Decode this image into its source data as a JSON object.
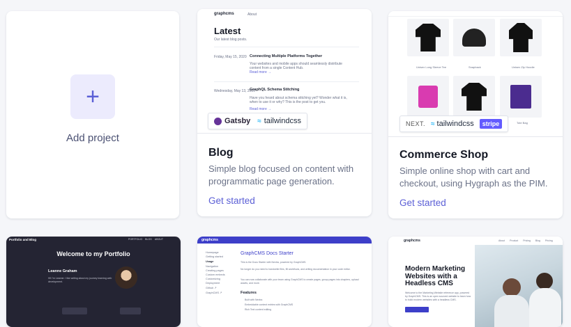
{
  "add_project": {
    "plus": "+",
    "label": "Add project"
  },
  "blog": {
    "title": "Blog",
    "description": "Simple blog focused on content with programmatic page generation.",
    "link": "Get started",
    "preview": {
      "brand": "graphcms",
      "nav": "About",
      "heading": "Latest",
      "subheading": "Our latest blog posts.",
      "posts": [
        {
          "date": "Friday, May 15, 2020",
          "title": "Connecting Multiple Platforms Together",
          "excerpt": "Your websites and mobile apps should seamlessly distribute content from a single Content Hub.",
          "more": "Read more →"
        },
        {
          "date": "Wednesday, May 13, 2020",
          "title": "GraphQL Schema Stitching",
          "excerpt": "Have you heard about schema stitching yet? Wonder what it is, when to use it or why? This is the post to get you.",
          "more": "Read more →"
        }
      ],
      "logos": [
        "Gatsby",
        "tailwindcss"
      ]
    }
  },
  "commerce": {
    "title": "Commerce Shop",
    "description": "Simple online shop with cart and checkout, using Hygraph as the PIM.",
    "link": "Get started",
    "preview": {
      "products": [
        "Unisex Long Sleeve Tee",
        "Snapback",
        "Unisex Zip Hoodie",
        "",
        "",
        "Tote Bag"
      ],
      "logos": [
        "NEXT.",
        "tailwindcss",
        "stripe"
      ]
    }
  },
  "portfolio": {
    "preview": {
      "brand": "Portfolio and Blog",
      "nav": [
        "PORTFOLIO",
        "BLOG",
        "ABOUT"
      ],
      "heading": "Welcome to my Portfolio",
      "name": "Leanne Graham",
      "bio": "Hi! I'm Leanne. I like writing about my journey learning web development."
    }
  },
  "docs": {
    "preview": {
      "brand": "graphcms",
      "sidebar": [
        "Homepage",
        "Getting started",
        "Usage",
        "Navigation",
        "Creating pages",
        "Custom embeds",
        "Customizing",
        "Deployment",
        "Github ↗",
        "GraphCMS ↗"
      ],
      "heading": "GraphCMS Docs Starter",
      "lines": [
        "This is the Docs Starter with Nextra, powered by GraphCMS.",
        "No longer do you need to handwrite files, fill workflows, and writing documentation in your code editor.",
        "You can now collaborate with your team using GraphCMS to create pages, group pages into chapters, upload assets, and more."
      ],
      "features_heading": "Features",
      "features": [
        "Built with Nextra",
        "Embeddable content entries with GraphCMS",
        "Rich Text content editing"
      ]
    }
  },
  "marketing": {
    "preview": {
      "brand": "graphcms",
      "nav": [
        "About",
        "Product",
        "Pricing",
        "Blog",
        "Pricing"
      ],
      "heading": "Modern Marketing Websites with a Headless CMS",
      "body": "Welcome to the Marketing Website reference app, powered by GraphCMS. This is an open sourced website to learn how to build modern websites with a headless CMS."
    }
  },
  "colors": {
    "accent": "#5b5fd6",
    "plus_bg": "#ecebfd",
    "dark_bg": "#1f1f2e",
    "docs_bar": "#3d3fc9"
  }
}
